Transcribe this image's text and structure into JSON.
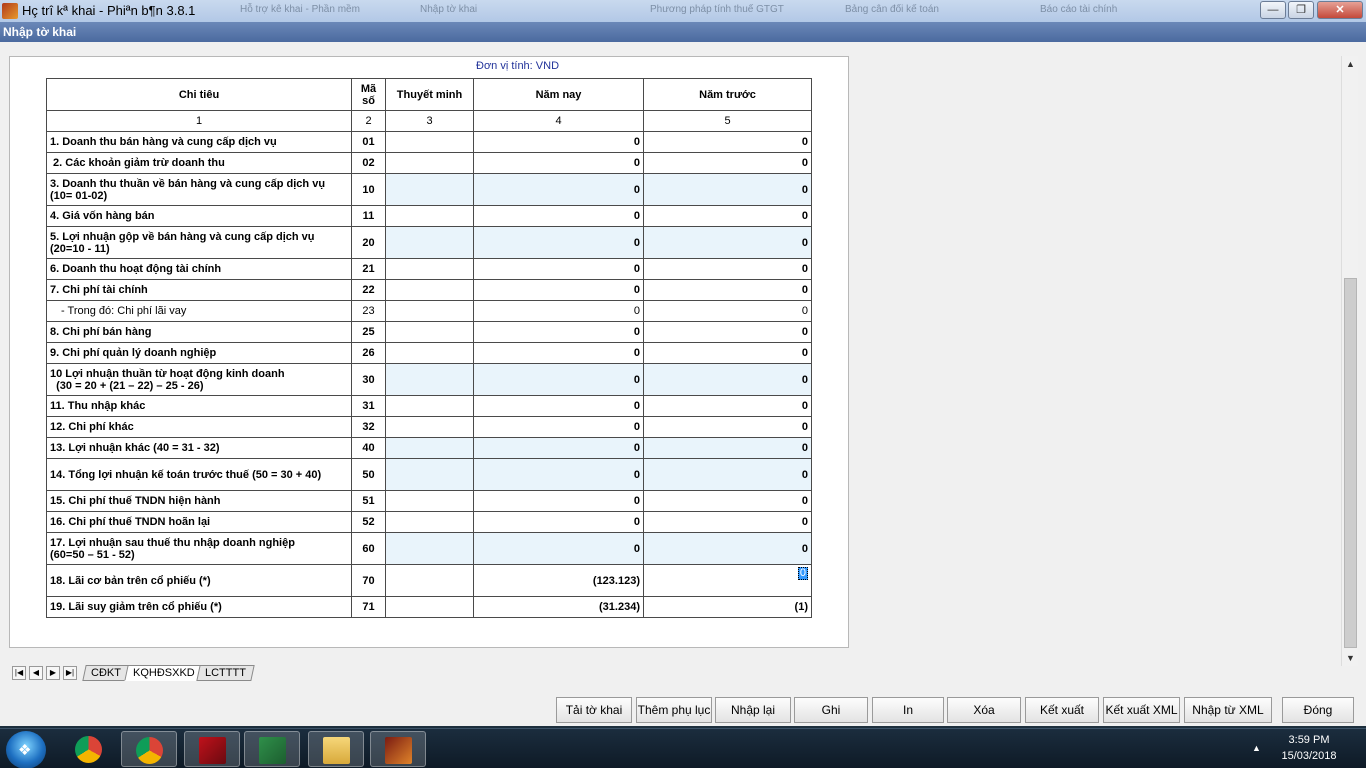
{
  "window": {
    "title": "Hç trî kª khai - Phiªn b¶n 3.8.1",
    "subtitle": "Nhập tờ khai",
    "ghost_tabs": [
      "Hỗ trợ kê khai - Phần mềm",
      "Nhập tờ khai",
      "Phương pháp tính thuế GTGT",
      "Bảng cân đối kế toán",
      "Báo cáo tài chính"
    ]
  },
  "unit_label": "Đơn vị tính: VND",
  "table": {
    "headers": {
      "chi_tieu": "Chi tiêu",
      "ma_so_1": "Mã",
      "ma_so_2": "số",
      "thuyet_minh": "Thuyết minh",
      "nam_nay": "Năm nay",
      "nam_truoc": "Năm trước"
    },
    "col_numbers": [
      "1",
      "2",
      "3",
      "4",
      "5"
    ],
    "rows": [
      {
        "label": "1. Doanh thu bán hàng và cung cấp dịch vụ",
        "code": "01",
        "note": "",
        "current": "0",
        "previous": "0"
      },
      {
        "label": " 2. Các khoản giảm trừ doanh thu",
        "code": "02",
        "note": "",
        "current": "0",
        "previous": "0"
      },
      {
        "label": "3. Doanh thu thuần về bán hàng và cung cấp dịch vụ",
        "label2": "(10= 01-02)",
        "code": "10",
        "note": "",
        "current": "0",
        "previous": "0"
      },
      {
        "label": "4. Giá vốn hàng bán",
        "code": "11",
        "note": "",
        "current": "0",
        "previous": "0"
      },
      {
        "label": "5. Lợi nhuận gộp về bán hàng và cung cấp dịch vụ",
        "label2": "(20=10 - 11)",
        "code": "20",
        "note": "",
        "current": "0",
        "previous": "0"
      },
      {
        "label": "6. Doanh thu hoạt động tài chính",
        "code": "21",
        "note": "",
        "current": "0",
        "previous": "0"
      },
      {
        "label": "7. Chi phí tài chính",
        "code": "22",
        "note": "",
        "current": "0",
        "previous": "0"
      },
      {
        "label": "- Trong đó: Chi phí lãi vay",
        "code": "23",
        "note": "",
        "current": "0",
        "previous": "0"
      },
      {
        "label": "8. Chi phí bán hàng",
        "code": "25",
        "note": "",
        "current": "0",
        "previous": "0"
      },
      {
        "label": "9. Chi phí quản lý doanh nghiệp",
        "code": "26",
        "note": "",
        "current": "0",
        "previous": "0"
      },
      {
        "label": "10 Lợi nhuận thuần từ hoạt động kinh doanh",
        "label2": "  (30 = 20 + (21 – 22) – 25 - 26)",
        "code": "30",
        "note": "",
        "current": "0",
        "previous": "0"
      },
      {
        "label": "11. Thu nhập khác",
        "code": "31",
        "note": "",
        "current": "0",
        "previous": "0"
      },
      {
        "label": "12. Chi phí khác",
        "code": "32",
        "note": "",
        "current": "0",
        "previous": "0"
      },
      {
        "label": "13. Lợi nhuận khác (40 = 31 - 32)",
        "code": "40",
        "note": "",
        "current": "0",
        "previous": "0"
      },
      {
        "label": "14. Tổng lợi nhuận kế toán trước thuế (50 = 30 + 40)",
        "code": "50",
        "note": "",
        "current": "0",
        "previous": "0"
      },
      {
        "label": "15. Chi phí thuế TNDN hiện hành",
        "code": "51",
        "note": "",
        "current": "0",
        "previous": "0"
      },
      {
        "label": "16. Chi phí thuế TNDN hoãn lại",
        "code": "52",
        "note": "",
        "current": "0",
        "previous": "0"
      },
      {
        "label": "17. Lợi nhuận sau thuế thu nhập doanh nghiệp",
        "label2": "(60=50 – 51 - 52)",
        "code": "60",
        "note": "",
        "current": "0",
        "previous": "0"
      },
      {
        "label": "18. Lãi cơ bản trên cổ phiếu (*)",
        "code": "70",
        "note": "",
        "current": "(123.123)",
        "previous": "0"
      },
      {
        "label": "19. Lãi suy giảm trên cổ phiếu (*)",
        "code": "71",
        "note": "",
        "current": "(31.234)",
        "previous": "(1)"
      }
    ]
  },
  "sheet_nav": [
    "|◀",
    "◀",
    "▶",
    "▶|"
  ],
  "sheets": [
    "CĐKT",
    "KQHĐSXKD",
    "LCTTTT"
  ],
  "buttons": [
    "Tải tờ khai",
    "Thêm phụ lục",
    "Nhập lại",
    "Ghi",
    "In",
    "Xóa",
    "Kết xuất",
    "Kết xuất XML",
    "Nhập từ XML",
    "Đóng"
  ],
  "taskbar": {
    "time": "3:59 PM",
    "date": "15/03/2018",
    "apps": [
      "chrome-icon",
      "chrome-icon",
      "vietnamese-app-icon",
      "excel-icon",
      "file-explorer-icon",
      "htkk-icon"
    ]
  }
}
